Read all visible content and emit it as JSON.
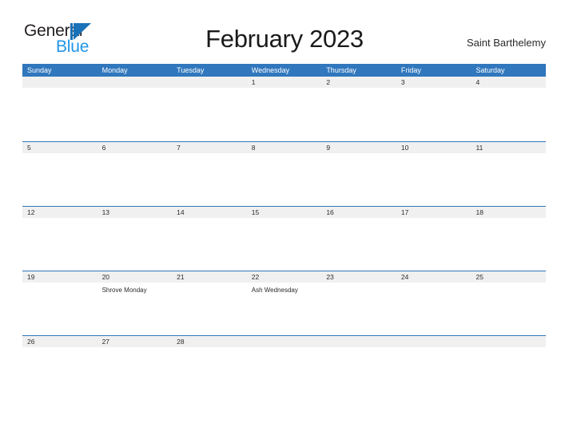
{
  "brand": {
    "name_part1": "General",
    "name_part2": "Blue",
    "mark": "triangle-logo",
    "color_dark": "#231f20",
    "color_blue": "#1a72b8",
    "color_light_blue": "#2196e8"
  },
  "header": {
    "title": "February 2023",
    "locale": "Saint Barthelemy"
  },
  "calendar": {
    "accent_color": "#3077bd",
    "band_color": "#f0f0f0",
    "weekdays": [
      "Sunday",
      "Monday",
      "Tuesday",
      "Wednesday",
      "Thursday",
      "Friday",
      "Saturday"
    ],
    "weeks": [
      {
        "days": [
          {
            "num": "",
            "events": []
          },
          {
            "num": "",
            "events": []
          },
          {
            "num": "",
            "events": []
          },
          {
            "num": "1",
            "events": []
          },
          {
            "num": "2",
            "events": []
          },
          {
            "num": "3",
            "events": []
          },
          {
            "num": "4",
            "events": []
          }
        ]
      },
      {
        "days": [
          {
            "num": "5",
            "events": []
          },
          {
            "num": "6",
            "events": []
          },
          {
            "num": "7",
            "events": []
          },
          {
            "num": "8",
            "events": []
          },
          {
            "num": "9",
            "events": []
          },
          {
            "num": "10",
            "events": []
          },
          {
            "num": "11",
            "events": []
          }
        ]
      },
      {
        "days": [
          {
            "num": "12",
            "events": []
          },
          {
            "num": "13",
            "events": []
          },
          {
            "num": "14",
            "events": []
          },
          {
            "num": "15",
            "events": []
          },
          {
            "num": "16",
            "events": []
          },
          {
            "num": "17",
            "events": []
          },
          {
            "num": "18",
            "events": []
          }
        ]
      },
      {
        "days": [
          {
            "num": "19",
            "events": []
          },
          {
            "num": "20",
            "events": [
              "Shrove Monday"
            ]
          },
          {
            "num": "21",
            "events": []
          },
          {
            "num": "22",
            "events": [
              "Ash Wednesday"
            ]
          },
          {
            "num": "23",
            "events": []
          },
          {
            "num": "24",
            "events": []
          },
          {
            "num": "25",
            "events": []
          }
        ]
      },
      {
        "days": [
          {
            "num": "26",
            "events": []
          },
          {
            "num": "27",
            "events": []
          },
          {
            "num": "28",
            "events": []
          },
          {
            "num": "",
            "events": []
          },
          {
            "num": "",
            "events": []
          },
          {
            "num": "",
            "events": []
          },
          {
            "num": "",
            "events": []
          }
        ]
      }
    ]
  }
}
